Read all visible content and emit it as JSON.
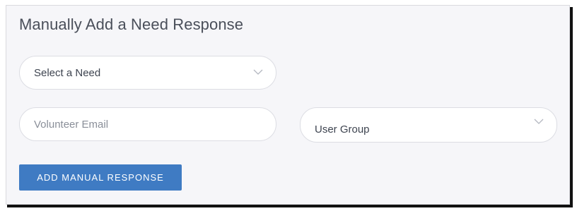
{
  "panel": {
    "title": "Manually Add a Need Response"
  },
  "form": {
    "need_select": {
      "selected_label": "Select a Need",
      "icon": "chevron-down-icon"
    },
    "volunteer_email": {
      "placeholder": "Volunteer Email",
      "value": ""
    },
    "user_group_select": {
      "selected_label": "User Group",
      "icon": "chevron-down-icon"
    },
    "submit_label": "ADD MANUAL RESPONSE"
  },
  "colors": {
    "accent": "#3f7bc3",
    "panel_background": "#f6f6f9",
    "title_text": "#4a4f5a"
  }
}
